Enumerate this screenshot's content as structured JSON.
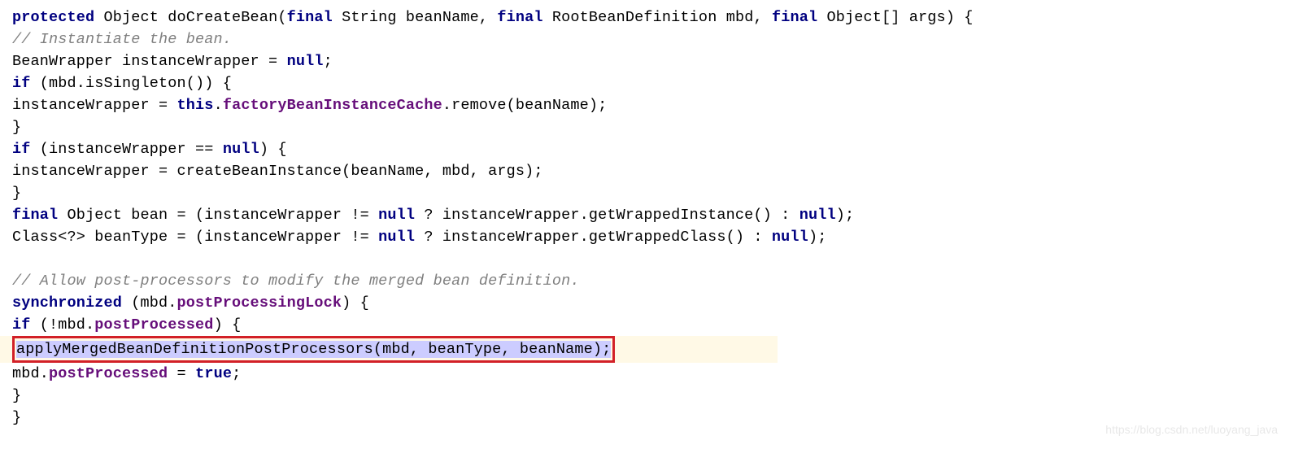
{
  "line1": {
    "t1": "protected",
    "t2": " Object doCreateBean(",
    "t3": "final",
    "t4": " String beanName, ",
    "t5": "final",
    "t6": " RootBeanDefinition mbd, ",
    "t7": "final",
    "t8": " Object[] args) {"
  },
  "line2": {
    "t1": "// Instantiate the bean."
  },
  "line3": {
    "t1": "BeanWrapper instanceWrapper = ",
    "t2": "null",
    "t3": ";"
  },
  "line4": {
    "t1": "if",
    "t2": " (mbd.isSingleton()) {"
  },
  "line5": {
    "t1": "instanceWrapper = ",
    "t2": "this",
    "t3": ".",
    "t4": "factoryBeanInstanceCache",
    "t5": ".remove(beanName);"
  },
  "line6": {
    "t1": "}"
  },
  "line7": {
    "t1": "if",
    "t2": " (instanceWrapper == ",
    "t3": "null",
    "t4": ") {"
  },
  "line8": {
    "t1": "instanceWrapper = createBeanInstance(beanName, mbd, args);"
  },
  "line9": {
    "t1": "}"
  },
  "line10": {
    "t1": "final",
    "t2": " Object bean = (instanceWrapper != ",
    "t3": "null",
    "t4": " ? instanceWrapper.getWrappedInstance() : ",
    "t5": "null",
    "t6": ");"
  },
  "line11": {
    "t1": "Class<?> beanType = (instanceWrapper != ",
    "t2": "null",
    "t3": " ? instanceWrapper.getWrappedClass() : ",
    "t4": "null",
    "t5": ");"
  },
  "line12": {
    "t1": "// Allow post-processors to modify the merged bean definition."
  },
  "line13": {
    "t1": "synchronized",
    "t2": " (mbd.",
    "t3": "postProcessingLock",
    "t4": ") {"
  },
  "line14": {
    "t1": "if",
    "t2": " (!mbd.",
    "t3": "postProcessed",
    "t4": ") {"
  },
  "line15": {
    "t1": "applyMergedBeanDefinitionPostProcessors(mbd, beanType, beanName);"
  },
  "line16": {
    "t1": "mbd.",
    "t2": "postProcessed",
    "t3": " = ",
    "t4": "true",
    "t5": ";"
  },
  "line17": {
    "t1": "}"
  },
  "line18": {
    "t1": "}"
  },
  "watermark": "https://blog.csdn.net/luoyang_java"
}
